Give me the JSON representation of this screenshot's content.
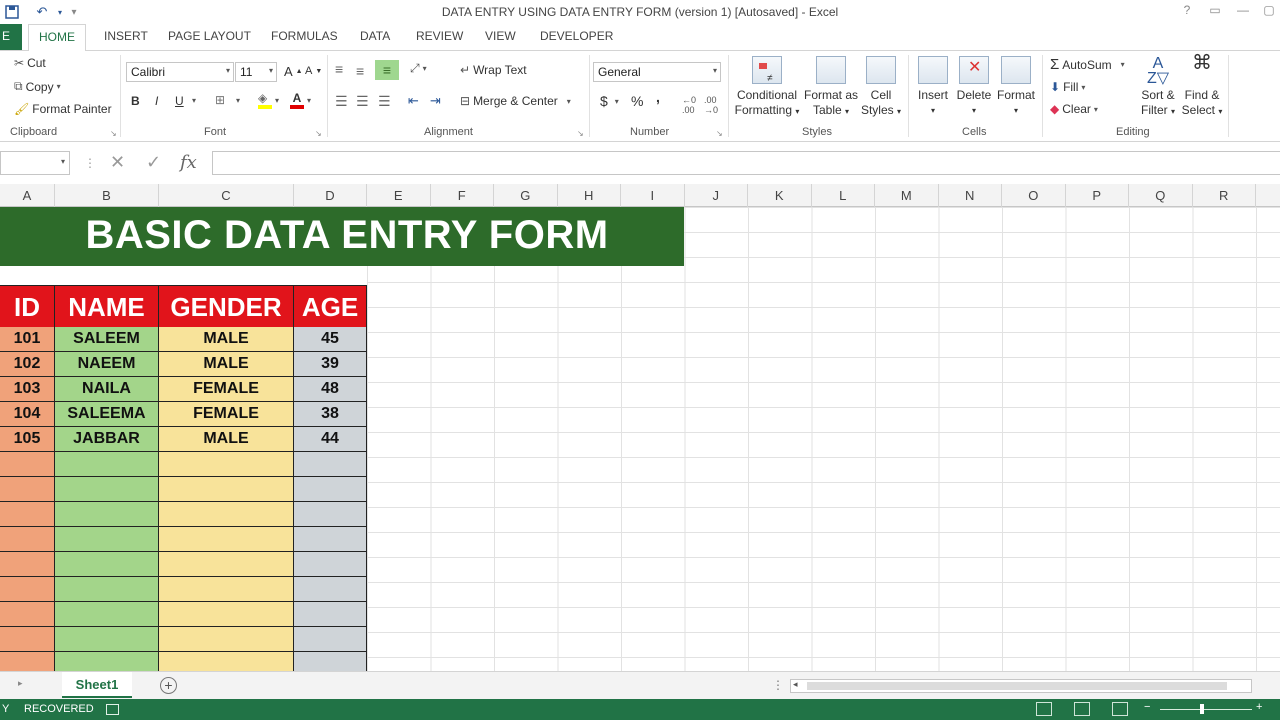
{
  "window": {
    "title": "DATA ENTRY USING DATA ENTRY FORM (version 1) [Autosaved] - Excel",
    "help": "?"
  },
  "ribbon_tabs": {
    "file": "E",
    "items": [
      "HOME",
      "INSERT",
      "PAGE LAYOUT",
      "FORMULAS",
      "DATA",
      "REVIEW",
      "VIEW",
      "DEVELOPER"
    ]
  },
  "clipboard": {
    "cut": "Cut",
    "copy": "Copy",
    "format_painter": "Format Painter",
    "label": "Clipboard"
  },
  "font": {
    "family": "Calibri",
    "size": "11",
    "bold": "B",
    "italic": "I",
    "underline": "U",
    "color_letter": "A",
    "label": "Font"
  },
  "alignment": {
    "wrap_text": "Wrap Text",
    "merge_center": "Merge & Center",
    "label": "Alignment"
  },
  "number": {
    "format": "General",
    "currency": "$",
    "percent": "%",
    "comma": ",",
    "label": "Number"
  },
  "styles": {
    "conditional": "Conditional",
    "formatting": "Formatting",
    "format_as": "Format as",
    "table": "Table",
    "cell": "Cell",
    "cell_styles": "Styles",
    "label": "Styles"
  },
  "cells": {
    "insert": "Insert",
    "delete": "Delete",
    "format": "Format",
    "label": "Cells"
  },
  "editing": {
    "autosum": "AutoSum",
    "fill": "Fill",
    "clear": "Clear",
    "sort": "Sort &",
    "filter": "Filter",
    "find": "Find &",
    "select": "Select",
    "label": "Editing"
  },
  "formula_bar": {
    "fx": "fx",
    "cancel": "✕",
    "enter": "✓"
  },
  "columns": [
    "A",
    "B",
    "C",
    "D",
    "E",
    "F",
    "G",
    "H",
    "I",
    "J",
    "K",
    "L",
    "M",
    "N",
    "O",
    "P",
    "Q",
    "R"
  ],
  "sheet_content": {
    "banner": "BASIC DATA ENTRY FORM",
    "headers": [
      "ID",
      "NAME",
      "GENDER",
      "AGE"
    ],
    "rows": [
      [
        "101",
        "SALEEM",
        "MALE",
        "45"
      ],
      [
        "102",
        "NAEEM",
        "MALE",
        "39"
      ],
      [
        "103",
        "NAILA",
        "FEMALE",
        "48"
      ],
      [
        "104",
        "SALEEMA",
        "FEMALE",
        "38"
      ],
      [
        "105",
        "JABBAR",
        "MALE",
        "44"
      ]
    ]
  },
  "sheet_tabs": {
    "active": "Sheet1",
    "add": "+"
  },
  "status": {
    "left": "Y",
    "mode": "RECOVERED"
  },
  "colors": {
    "excel_green": "#217346",
    "banner_green": "#2d6b2a",
    "header_red": "#e1141b",
    "id_orange": "#f0a27a",
    "name_green": "#a3d58a",
    "gender_yellow": "#f8e39a",
    "age_gray": "#cfd4d8"
  }
}
